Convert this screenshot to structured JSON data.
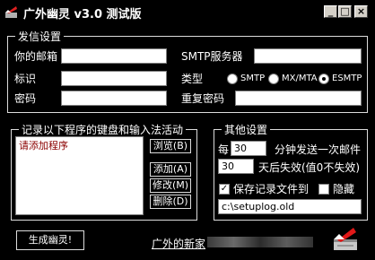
{
  "window": {
    "title": "广外幽灵 v3.0 测试版",
    "min_glyph": "_",
    "max_glyph": "□",
    "close_glyph": "×"
  },
  "send_settings": {
    "title": "发信设置",
    "email_label": "你的邮箱",
    "email_value": "",
    "smtp_label": "SMTP服务器",
    "smtp_value": "",
    "id_label": "标识",
    "id_value": "",
    "type_label": "类型",
    "types": [
      {
        "label": "SMTP",
        "checked": false
      },
      {
        "label": "MX/MTA",
        "checked": false
      },
      {
        "label": "ESMTP",
        "checked": true
      }
    ],
    "password_label": "密码",
    "password_value": "",
    "repeat_label": "重复密码",
    "repeat_value": ""
  },
  "record": {
    "title": "记录以下程序的键盘和输入法活动",
    "items": [
      "请添加程序"
    ],
    "browse": "浏览(B)",
    "add": "添加(A)",
    "modify": "修改(M)",
    "delete": "删除(D)"
  },
  "other": {
    "title": "其他设置",
    "every_prefix": "每",
    "minutes_value": "30",
    "minutes_suffix": "分钟发送一次邮件",
    "days_value": "30",
    "days_suffix": "天后失效(值0不失效)",
    "save_log_label": "保存记录文件到",
    "save_log_checked": true,
    "hide_label": "隐藏",
    "hide_checked": false,
    "log_path": "c:\\setuplog.old"
  },
  "footer": {
    "generate_label": "生成幽灵!",
    "link_prefix": "广外的新家"
  }
}
